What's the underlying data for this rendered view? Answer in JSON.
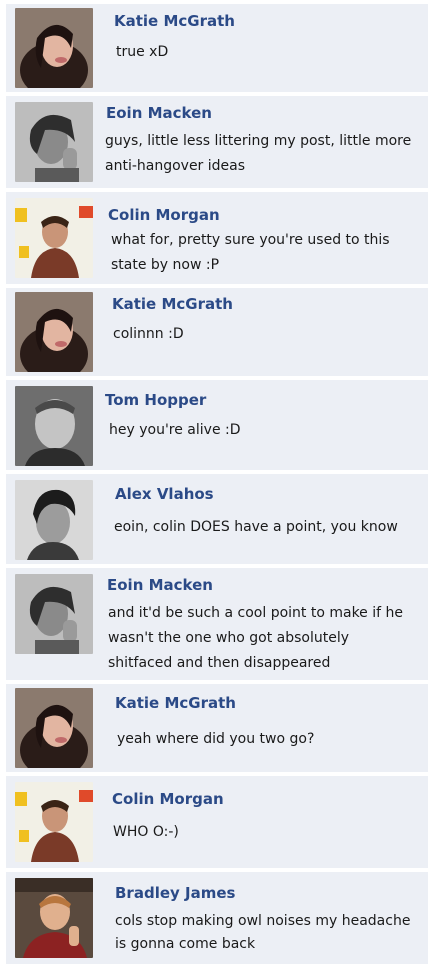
{
  "comments": [
    {
      "author": "Katie McGrath",
      "text": "true xD",
      "avatar": "katie-photo"
    },
    {
      "author": "Eoin Macken",
      "text": "guys, little less littering my post, little more anti-hangover ideas",
      "avatar": "eoin-photo"
    },
    {
      "author": "Colin Morgan",
      "text": "what for, pretty sure you're used to this state by now :P",
      "avatar": "colin-photo"
    },
    {
      "author": "Katie McGrath",
      "text": "colinnn :D",
      "avatar": "katie-photo"
    },
    {
      "author": "Tom Hopper",
      "text": "hey you're alive :D",
      "avatar": "tom-photo"
    },
    {
      "author": "Alex Vlahos",
      "text": "eoin, colin DOES have a point, you know",
      "avatar": "alex-photo"
    },
    {
      "author": "Eoin Macken",
      "text": "and it'd be such a cool point to make if he wasn't the one who got absolutely shitfaced and then disappeared",
      "avatar": "eoin-photo"
    },
    {
      "author": "Katie McGrath",
      "text": "yeah where did you two go?",
      "avatar": "katie-photo"
    },
    {
      "author": "Colin Morgan",
      "text": "WHO O:-)",
      "avatar": "colin-photo"
    },
    {
      "author": "Bradley James",
      "text": "cols stop making owl noises my headache is gonna come back",
      "avatar": "bradley-photo"
    }
  ],
  "colors": {
    "panel": "#eceff5",
    "author": "#2b4a87",
    "text": "#1a1a1a"
  }
}
